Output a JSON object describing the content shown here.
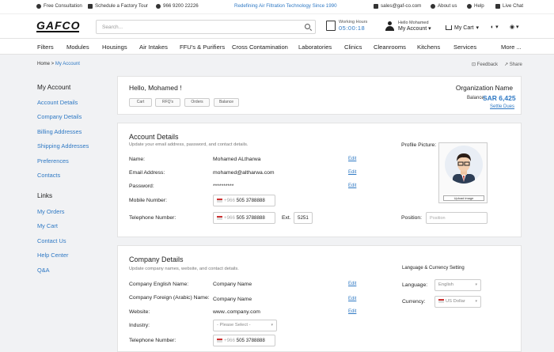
{
  "topbar": {
    "free_consultation": "Free Consultation",
    "schedule_tour": "Schedule a Factory Tour",
    "phone": "966 9200 22226",
    "tagline": "Redefining Air Filtration Technology Since 1990",
    "email": "sales@gaf-co.com",
    "about": "About us",
    "help": "Help",
    "live_chat": "Live Chat"
  },
  "header": {
    "logo": "GAFCO",
    "search_placeholder": "Search...",
    "working_hours_label": "Working Hours",
    "working_hours_value": "05:00:18",
    "hello": "Hello Mohamed",
    "my_account": "My Account",
    "my_cart": "My Cart",
    "account_caret": "▾",
    "cart_caret": "▾",
    "misc1": "◐ ▾",
    "misc2": "◉ ▾"
  },
  "nav": [
    "Filters",
    "Modules",
    "Housings",
    "Air Intakes",
    "FFU's & Purifiers",
    "Cross Contamination",
    "Laboratories",
    "Clinics",
    "Cleanrooms",
    "Kitchens",
    "Services",
    "More ..."
  ],
  "breadcrumb": {
    "home": "Home",
    "sep": " > ",
    "current": "My Account"
  },
  "page_actions": {
    "feedback": "Feedback",
    "share": "Share"
  },
  "sidebar": {
    "account_heading": "My Account",
    "account_links": [
      "Account Details",
      "Company Details",
      "Billing Addresses",
      "Shipping Addresses",
      "Preferences",
      "Contacts"
    ],
    "links_heading": "Links",
    "links": [
      "My Orders",
      "My Cart",
      "Contact Us",
      "Help Center",
      "Q&A"
    ]
  },
  "summary": {
    "greeting": "Hello, Mohamed !",
    "buttons": [
      "Cart",
      "RFQ's",
      "Orders",
      "Balance"
    ],
    "org_label": "Organization Name",
    "balance_label": "Balance:",
    "balance_value": "SAR 6,425",
    "settle": "Settle Dues"
  },
  "account_details": {
    "title": "Account Details",
    "subtitle": "Update your email address, password, and contact details.",
    "name_label": "Name:",
    "name_value": "Mohamed ALtharwa",
    "email_label": "Email Address:",
    "email_value": "mohamed@altharwa.com",
    "password_label": "Password:",
    "password_value": "**********",
    "mobile_label": "Mobile Number:",
    "mobile_code": "+966",
    "mobile_value": "505 3788888",
    "tel_label": "Telephone Number:",
    "tel_code": "+966",
    "tel_value": "505 3788888",
    "ext_label": "Ext.",
    "ext_value": "5251",
    "edit": "Edit",
    "profile_label": "Profile Picture:",
    "upload_label": "Upload image",
    "position_label": "Position:",
    "position_placeholder": "Position"
  },
  "company_details": {
    "title": "Company Details",
    "subtitle": "Update company names, website, and contact details.",
    "en_name_label": "Company English Name:",
    "en_name_value": "Company Name",
    "ar_name_label": "Company Foreign (Arabic) Name:",
    "ar_name_value": "Company Name",
    "website_label": "Website:",
    "website_value": "www..company.com",
    "industry_label": "Industry:",
    "industry_value": "- Please Select -",
    "tel_label": "Telephone Number:",
    "tel_code": "+966",
    "tel_value": "505 3788888",
    "edit": "Edit",
    "lang_heading": "Language & Currency Setting",
    "language_label": "Language:",
    "language_value": "English",
    "currency_label": "Currency:",
    "currency_value": "US Dollar"
  }
}
